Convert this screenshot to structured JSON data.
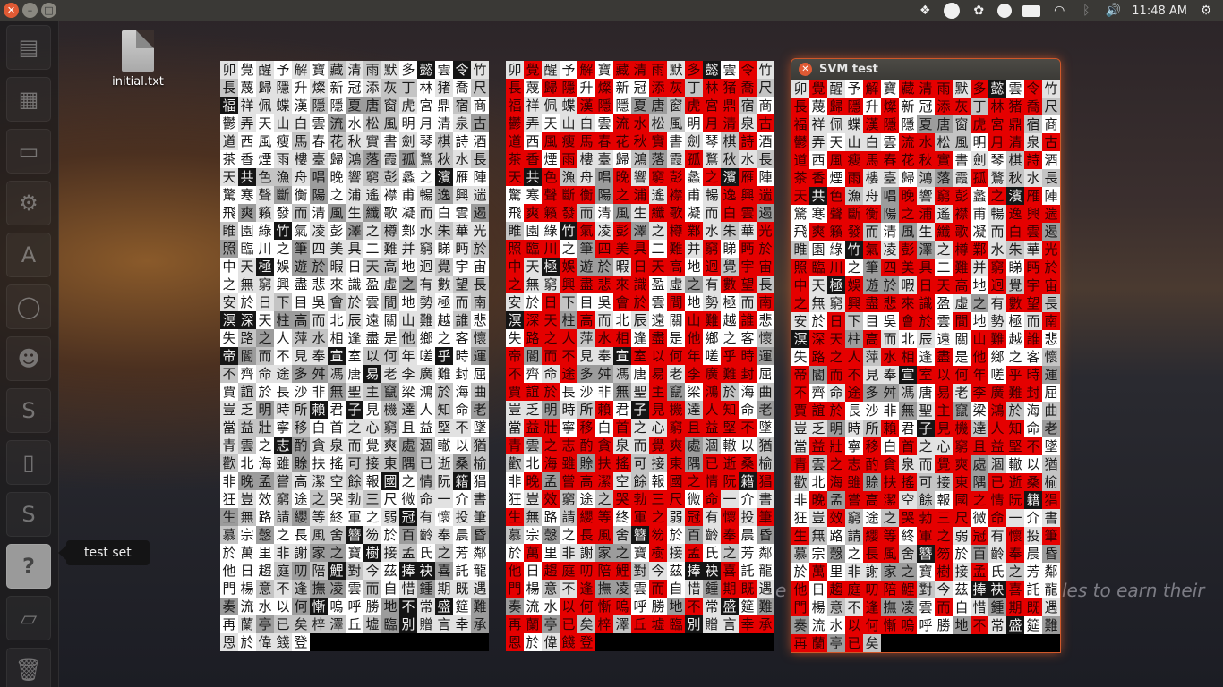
{
  "top_panel": {
    "clock": "11:48 AM"
  },
  "launcher": {
    "tooltip": "test set",
    "items": [
      {
        "name": "document-viewer-icon",
        "glyph": "▤"
      },
      {
        "name": "spreadsheet-icon",
        "glyph": "▦"
      },
      {
        "name": "presentation-icon",
        "glyph": "▭"
      },
      {
        "name": "settings-icon",
        "glyph": "⚙"
      },
      {
        "name": "software-center-icon",
        "glyph": "A"
      },
      {
        "name": "disk-icon",
        "glyph": "◯"
      },
      {
        "name": "gimp-icon",
        "glyph": "☻"
      },
      {
        "name": "sublime-icon",
        "glyph": "S"
      },
      {
        "name": "terminal-icon",
        "glyph": "▯"
      },
      {
        "name": "sublime-icon-2",
        "glyph": "S"
      },
      {
        "name": "unknown-app-icon",
        "glyph": "?"
      },
      {
        "name": "drive-icon",
        "glyph": "▱"
      },
      {
        "name": "trash-icon",
        "glyph": "🗑"
      }
    ]
  },
  "desktop": {
    "file_label": "initial.txt"
  },
  "background_text": {
    "left": "e",
    "right": "les to earn their"
  },
  "svm_window": {
    "title": "SVM test"
  },
  "colors": {
    "red": "#e50000",
    "close": "#e05a34",
    "accent": "#d0582a"
  },
  "characters": "卯覺醒予解寶藏清雨默多懿雲令竹長蔑歸隱升燦新冠添灰丁林猪喬尺福祥佩蝶漢隱隱夏唐窗虎宮鼎宿商鬱弄天山白雲流水松風明月清泉古道西風瘦馬春花秋實書劍琴棋詩酒茶香煙雨樓臺歸鴻落霞孤鶩秋水長天共色漁舟唱晚響窮彭蠡之濱雁陣驚寒聲斷衡陽之浦遙襟甫暢逸興遄飛爽籟發而清風生纖歌凝而白雲遏睢園綠竹氣凌彭澤之樽鄴水朱華光照臨川之筆四美具二難并窮睇眄於中天極娛遊於暇日天高地迥覺宇宙之無窮興盡悲來識盈虛之有數望長安於日下目吳會於雲間地勢極而南溟深天柱高而北辰遠關山難越誰悲失路之人萍水相逢盡是他鄉之客懷帝閽而不見奉宣室以何年嗟乎時運不齊命途多舛馮唐易老李廣難封屈賈誼於長沙非無聖主竄梁鴻於海曲豈乏明時所賴君子見機達人知命老當益壯寧移白首之心窮且益堅不墜青雲之志酌貪泉而覺爽處涸轍以猶歡北海雖賒扶搖可接東隅已逝桑榆非晚孟嘗高潔空餘報國之情阮籍猖狂豈效窮途之哭勃三尺微命一介書生無路請纓等終軍之弱冠有懷投筆慕宗愨之長風舍簪笏於百齡奉晨昏於萬里非謝家之寶樹接孟氏之芳鄰他日趨庭叨陪鯉對今茲捧袂喜託龍門楊意不逢撫凌雲而自惜鍾期既遇奏流水以何慚嗚呼勝地不常盛筵難再蘭亭已矣梓澤丘墟臨別贈言幸承恩於偉餞登高作賦是所望於群公敢竭鄙懷恭疏短引一言均賦四韻俱成請灑潘江各傾陸海云爾滕王高閣臨江渚佩玉鳴鸞罷歌舞畫棟朝飛南浦雲珠簾暮捲西山雨閒雲潭影日悠悠物換星移幾度秋閣中帝子今何在檻外長江空自流"
}
